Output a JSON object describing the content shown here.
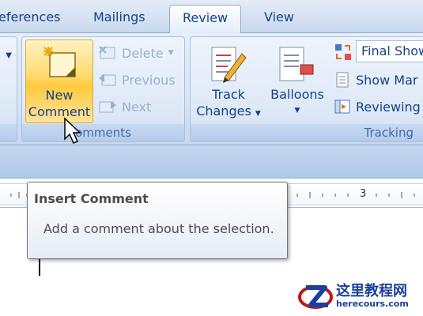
{
  "tabs": [
    {
      "label": "eferences",
      "active": false
    },
    {
      "label": "Mailings",
      "active": false
    },
    {
      "label": "Review",
      "active": true
    },
    {
      "label": "View",
      "active": false
    }
  ],
  "comments_group": {
    "label": "omments",
    "new_comment": {
      "line1": "New",
      "line2": "Comment"
    },
    "delete_label": "Delete",
    "previous_label": "Previous",
    "next_label": "Next"
  },
  "tracking_group": {
    "label": "Tracking",
    "track_changes": {
      "line1": "Track",
      "line2": "Changes"
    },
    "balloons_label": "Balloons",
    "display_value": "Final Show",
    "show_markup_label": "Show Mar",
    "reviewing_label": "Reviewing"
  },
  "ruler": {
    "mark": "3"
  },
  "tooltip": {
    "title": "Insert Comment",
    "body": "Add a comment about the selection."
  },
  "watermark": {
    "cn": "这里教程网",
    "en": "herecours.com"
  },
  "colors": {
    "accent": "#15428b",
    "hover": "#ffd96a",
    "ribbon": "#dde8f6"
  }
}
